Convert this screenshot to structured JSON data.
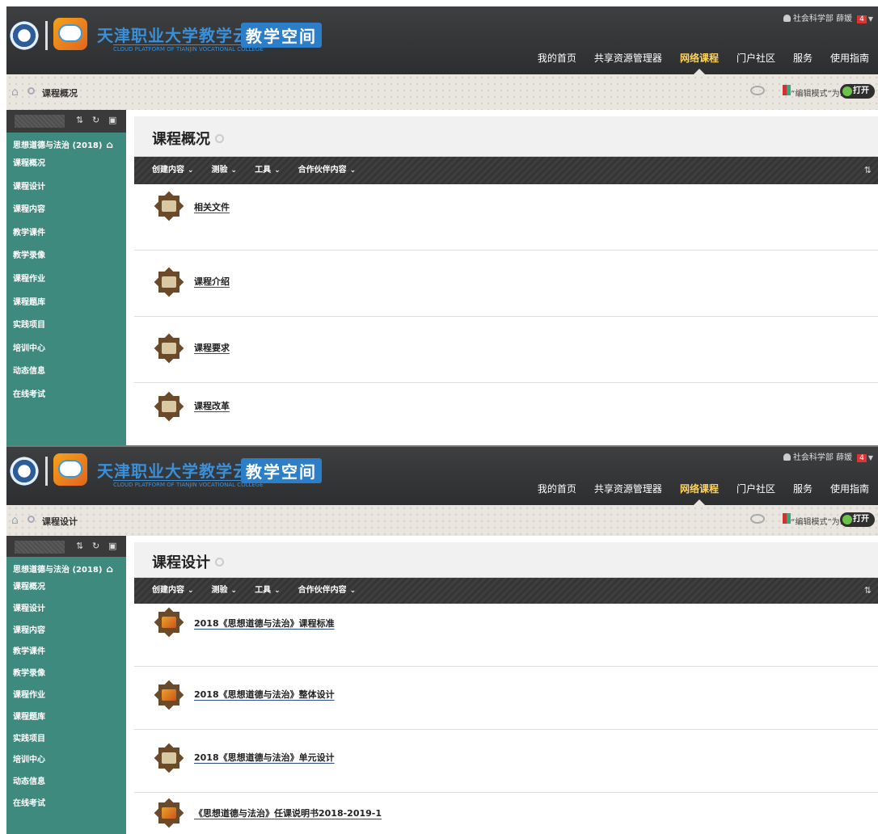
{
  "header": {
    "site_title": "天津职业大学教学云平台",
    "site_subtitle": "CLOUD PLATFORM OF TIANJIN VOCATIONAL COLLEGE",
    "space_label": "教学空间",
    "user_label": "社会科学部 薛媛",
    "notification_count": "4",
    "nav": [
      "我的首页",
      "共享资源管理器",
      "网络课程",
      "门户社区",
      "服务",
      "使用指南"
    ],
    "active_nav": "网络课程"
  },
  "edit_mode": {
    "label": "“编辑模式”为:",
    "toggle_label": "打开"
  },
  "sidebar": {
    "course_title": "思想道德与法治 (2018)",
    "items": [
      "课程概况",
      "课程设计",
      "课程内容",
      "教学课件",
      "教学录像",
      "课程作业",
      "课程题库",
      "实践项目",
      "培训中心",
      "动态信息",
      "在线考试"
    ]
  },
  "action_bar": {
    "buttons": [
      "创建内容",
      "测验",
      "工具",
      "合作伙伴内容"
    ]
  },
  "panels": [
    {
      "breadcrumb": "课程概况",
      "page_title": "课程概况",
      "items": [
        "相关文件",
        "课程介绍",
        "课程要求",
        "课程改革"
      ]
    },
    {
      "breadcrumb": "课程设计",
      "page_title": "课程设计",
      "items": [
        "2018《思想道德与法治》课程标准",
        "2018《思想道德与法治》整体设计",
        "2018《思想道德与法治》单元设计",
        "《思想道德与法治》任课说明书2018-2019-1"
      ]
    }
  ],
  "colors": {
    "header_bg": "#333537",
    "sidebar_bg": "#3e8a7e",
    "active_nav": "#ffd35a",
    "brand_blue": "#3a8fd9",
    "toggle_on": "#6dc24b"
  },
  "icons": {
    "home": "home-icon",
    "sort": "sort-icon",
    "refresh": "refresh-icon",
    "folder": "folder-icon",
    "item": "content-item-icon"
  }
}
